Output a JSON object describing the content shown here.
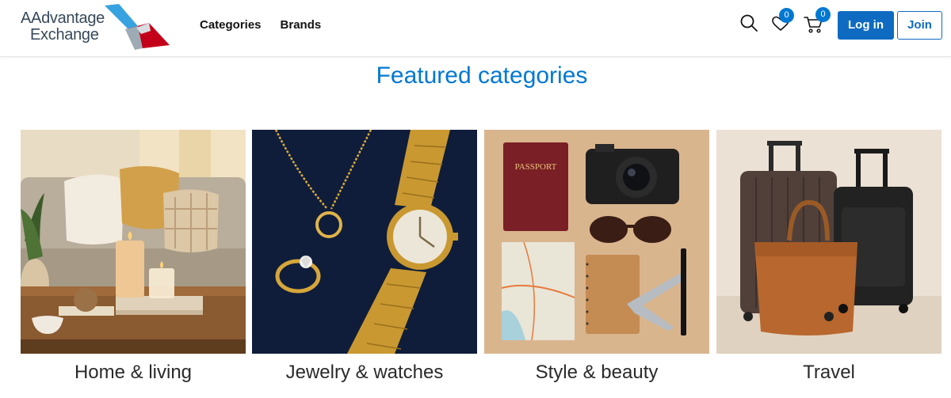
{
  "header": {
    "logo_line1": "AAdvantage",
    "logo_line2": "Exchange",
    "nav": [
      "Categories",
      "Brands"
    ],
    "wishlist_count": "0",
    "cart_count": "0",
    "login_label": "Log in",
    "join_label": "Join",
    "icons": [
      "search-icon",
      "heart-icon",
      "cart-icon"
    ]
  },
  "featured": {
    "title": "Featured categories",
    "categories": [
      {
        "label": "Home & living"
      },
      {
        "label": "Jewelry & watches"
      },
      {
        "label": "Style & beauty",
        "image_text": "PASSPORT"
      },
      {
        "label": "Travel"
      }
    ]
  },
  "colors": {
    "brand_blue": "#0078d2",
    "button_blue": "#0f6bc2",
    "logo_red": "#c30019",
    "logo_sky": "#36a3e0"
  }
}
